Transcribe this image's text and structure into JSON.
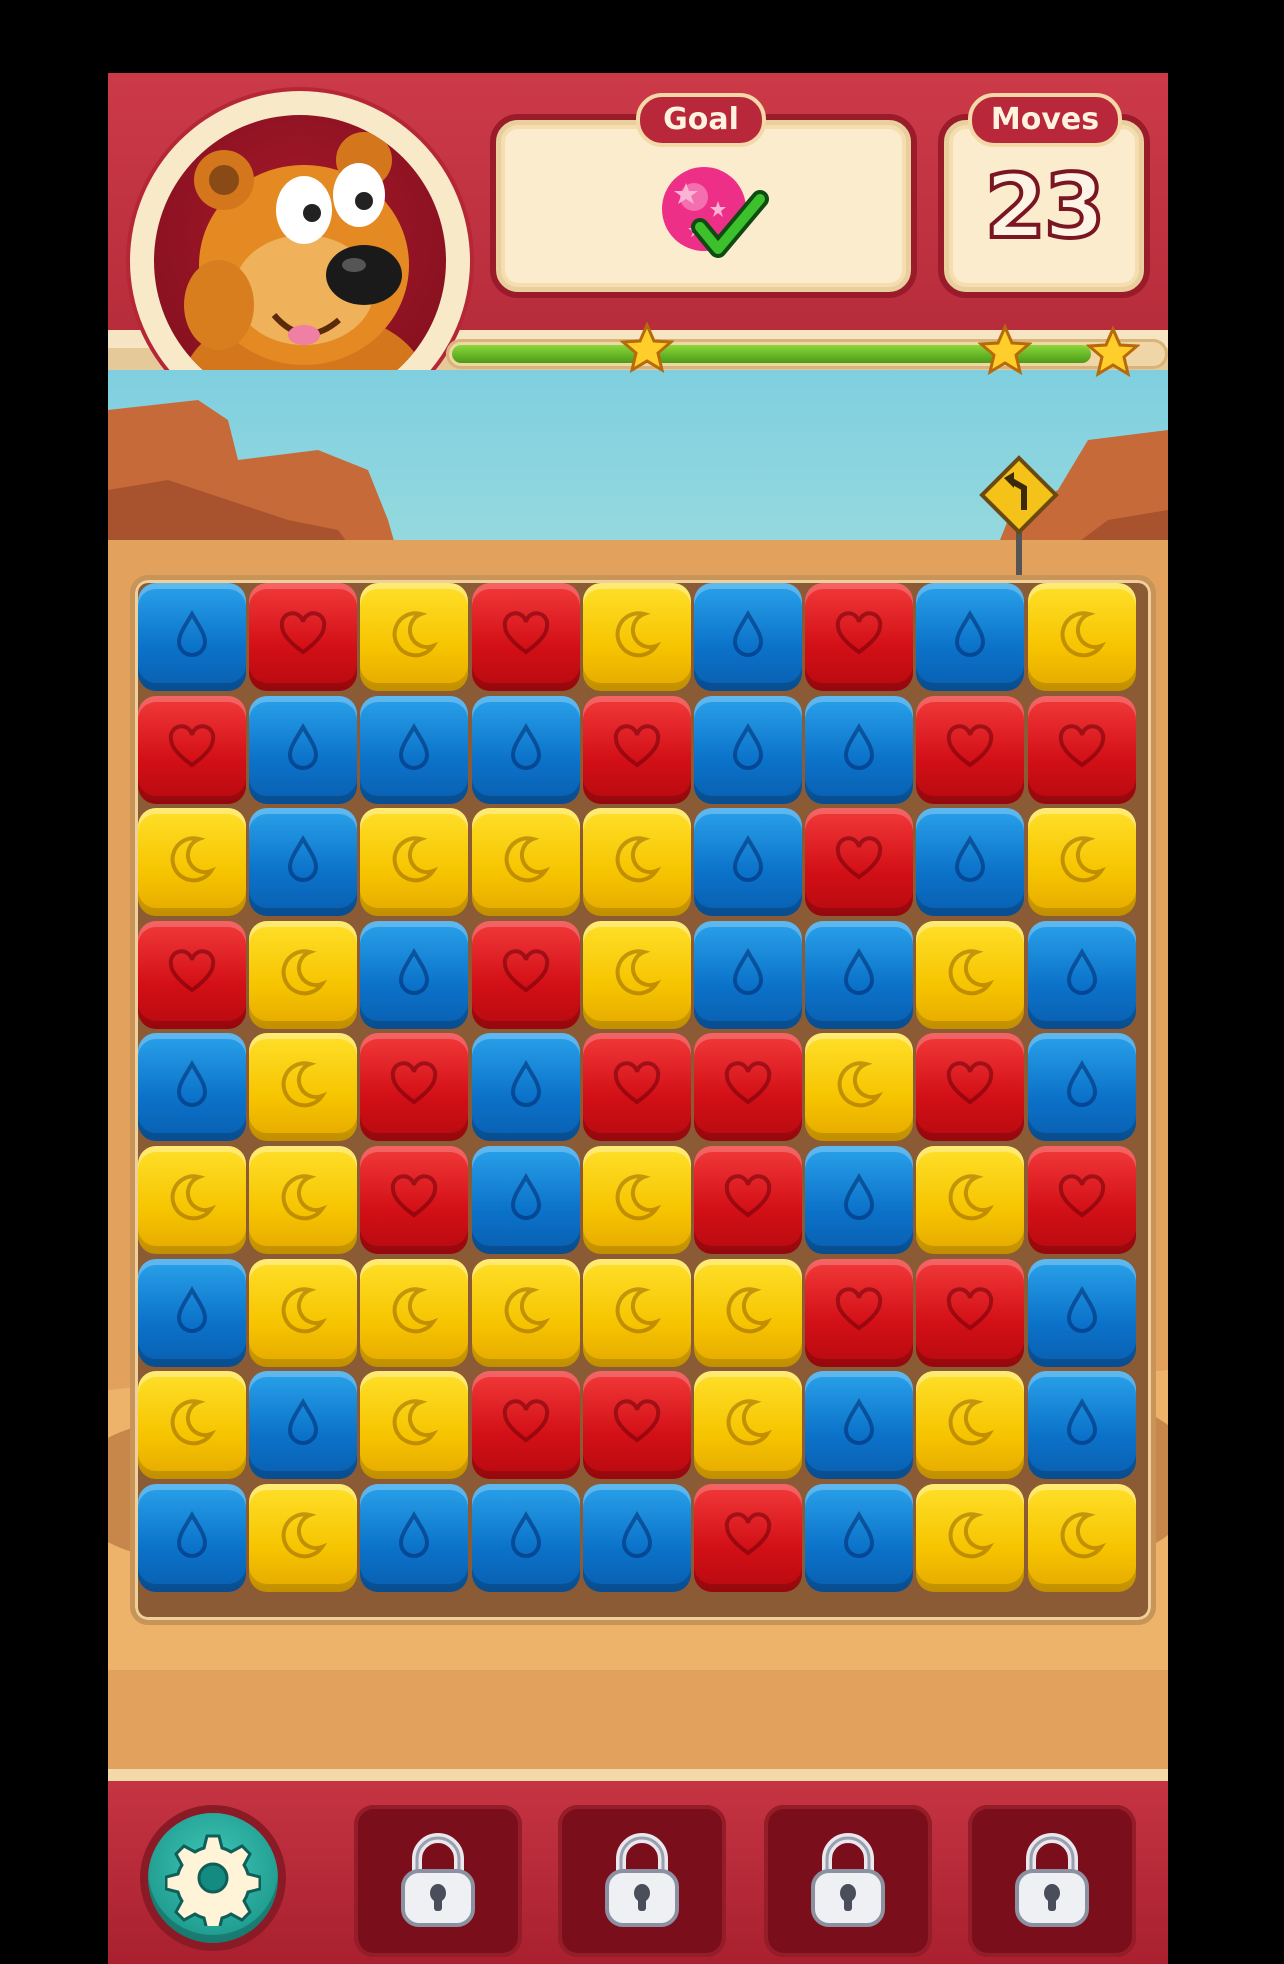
{
  "header": {
    "goal_label": "Goal",
    "moves_label": "Moves",
    "moves_value": "23",
    "goal_item": "pink-star-balloon-icon",
    "goal_completed": true
  },
  "progress": {
    "fill_fraction": 0.9,
    "stars_earned": 3,
    "stars_total": 3
  },
  "board": {
    "columns": 9,
    "rows": 9,
    "cube_types": {
      "B": {
        "color": "blue",
        "icon": "drop-icon"
      },
      "R": {
        "color": "red",
        "icon": "heart-icon"
      },
      "Y": {
        "color": "yellow",
        "icon": "moon-icon"
      }
    },
    "grid": [
      [
        "B",
        "R",
        "Y",
        "R",
        "Y",
        "B",
        "R",
        "B",
        "Y"
      ],
      [
        "R",
        "B",
        "B",
        "B",
        "R",
        "B",
        "B",
        "R",
        "R"
      ],
      [
        "Y",
        "B",
        "Y",
        "Y",
        "Y",
        "B",
        "R",
        "B",
        "Y"
      ],
      [
        "R",
        "Y",
        "B",
        "R",
        "Y",
        "B",
        "B",
        "Y",
        "B"
      ],
      [
        "B",
        "Y",
        "R",
        "B",
        "R",
        "R",
        "Y",
        "R",
        "B"
      ],
      [
        "Y",
        "Y",
        "R",
        "B",
        "Y",
        "R",
        "B",
        "Y",
        "R"
      ],
      [
        "B",
        "Y",
        "Y",
        "Y",
        "Y",
        "Y",
        "R",
        "R",
        "B"
      ],
      [
        "Y",
        "B",
        "Y",
        "R",
        "R",
        "Y",
        "B",
        "Y",
        "B"
      ],
      [
        "B",
        "Y",
        "B",
        "B",
        "B",
        "R",
        "B",
        "Y",
        "Y"
      ]
    ]
  },
  "footer": {
    "settings_icon": "gear-icon",
    "boosters": [
      {
        "icon": "lock-icon",
        "locked": true
      },
      {
        "icon": "lock-icon",
        "locked": true
      },
      {
        "icon": "lock-icon",
        "locked": true
      },
      {
        "icon": "lock-icon",
        "locked": true
      }
    ]
  },
  "colors": {
    "header_red": "#b72c3b",
    "cube_blue": "#0b72c9",
    "cube_red": "#d20f16",
    "cube_yellow": "#f6c400",
    "progress_green": "#4c9b16",
    "settings_teal": "#138b80"
  }
}
